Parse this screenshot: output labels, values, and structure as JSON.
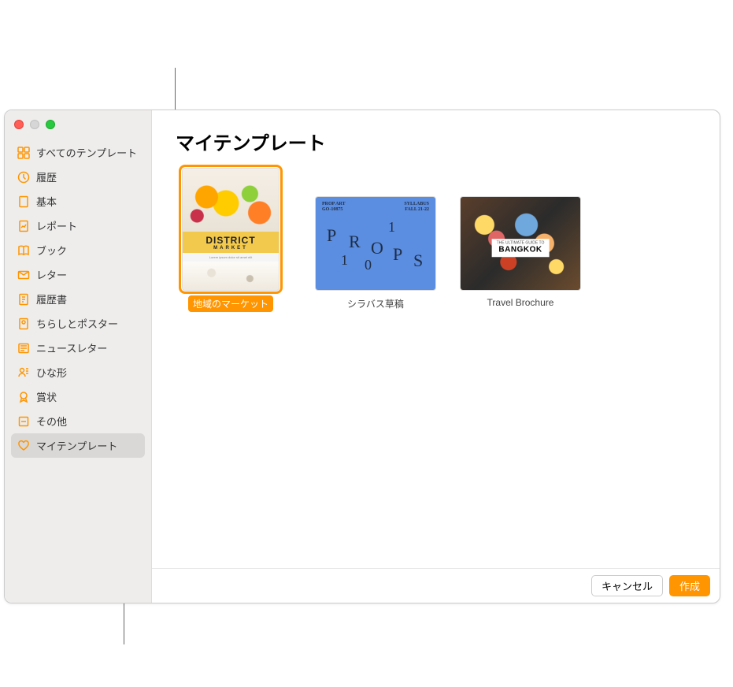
{
  "header": {
    "title": "マイテンプレート"
  },
  "sidebar": {
    "items": [
      {
        "label": "すべてのテンプレート",
        "icon": "templates-icon"
      },
      {
        "label": "履歴",
        "icon": "clock-icon"
      },
      {
        "label": "基本",
        "icon": "page-icon"
      },
      {
        "label": "レポート",
        "icon": "report-icon"
      },
      {
        "label": "ブック",
        "icon": "book-icon"
      },
      {
        "label": "レター",
        "icon": "letter-icon"
      },
      {
        "label": "履歴書",
        "icon": "resume-icon"
      },
      {
        "label": "ちらしとポスター",
        "icon": "flyer-icon"
      },
      {
        "label": "ニュースレター",
        "icon": "newsletter-icon"
      },
      {
        "label": "ひな形",
        "icon": "stationery-icon"
      },
      {
        "label": "賞状",
        "icon": "ribbon-icon"
      },
      {
        "label": "その他",
        "icon": "other-icon"
      },
      {
        "label": "マイテンプレート",
        "icon": "heart-icon"
      }
    ],
    "selected_index": 12
  },
  "templates": [
    {
      "label": "地域のマーケット",
      "selected": true,
      "orientation": "portrait",
      "preview": {
        "style": "district-market",
        "title": "DISTRICT",
        "subtitle": "MARKET"
      }
    },
    {
      "label": "シラバス草稿",
      "selected": false,
      "orientation": "landscape",
      "preview": {
        "style": "props-syllabus",
        "top_left": "PROP ART\nGO-10875",
        "top_right": "SYLLABUS\nFALL 21-22",
        "word": "PROPS",
        "digits": "110"
      }
    },
    {
      "label": "Travel Brochure",
      "selected": false,
      "orientation": "landscape",
      "preview": {
        "style": "bangkok",
        "tag_small": "THE ULTIMATE GUIDE TO",
        "tag_big": "BANGKOK"
      }
    }
  ],
  "footer": {
    "cancel": "キャンセル",
    "create": "作成"
  }
}
